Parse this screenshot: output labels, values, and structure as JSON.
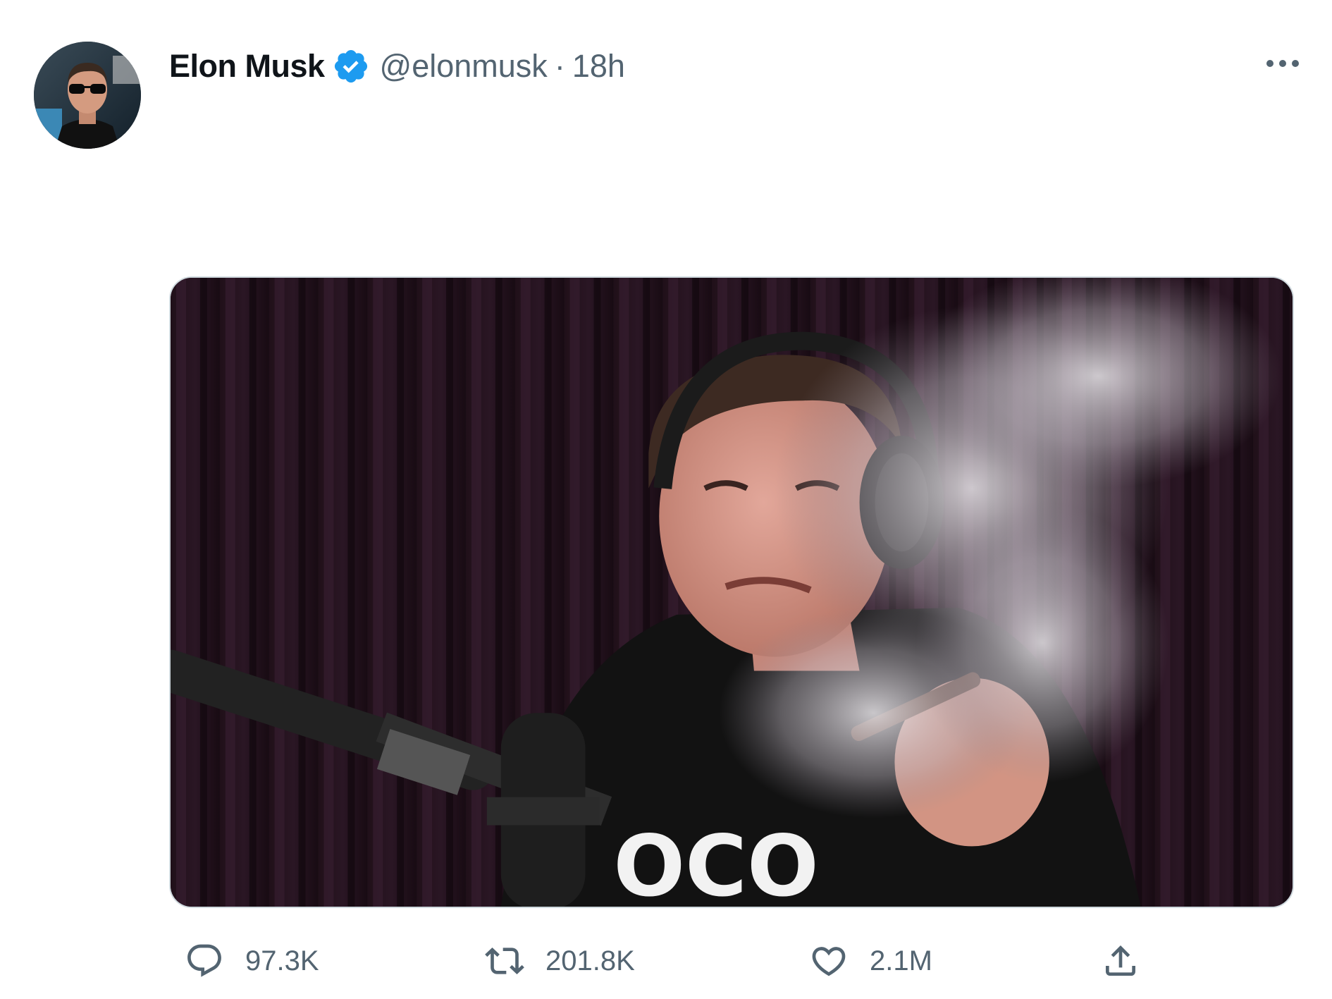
{
  "tweet": {
    "author": {
      "display_name": "Elon Musk",
      "handle": "@elonmusk",
      "verified": true,
      "avatar_icon": "profile-photo-sunglasses"
    },
    "separator": "·",
    "timestamp": "18h",
    "more_icon": "more-horizontal-icon",
    "media": {
      "kind": "photo",
      "image_text": "OCO"
    },
    "actions": {
      "reply": {
        "icon": "reply-icon",
        "count": "97.3K"
      },
      "retweet": {
        "icon": "retweet-icon",
        "count": "201.8K"
      },
      "like": {
        "icon": "heart-icon",
        "count": "2.1M"
      },
      "share": {
        "icon": "share-icon"
      }
    }
  },
  "colors": {
    "text_primary": "#0f1419",
    "text_secondary": "#536471",
    "verified_blue": "#1d9bf0",
    "media_border": "#cfd9de"
  }
}
